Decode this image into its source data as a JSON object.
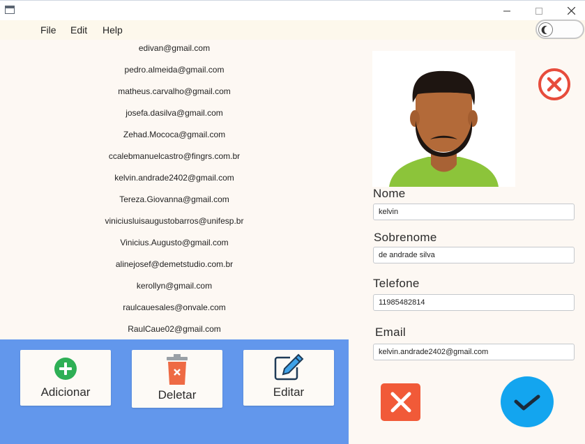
{
  "menu": {
    "items": [
      "File",
      "Edit",
      "Help"
    ]
  },
  "emails": [
    "edivan@gmail.com",
    "pedro.almeida@gmail.com",
    "matheus.carvalho@gmail.com",
    "josefa.dasilva@gmail.com",
    "Zehad.Mococa@gmail.com",
    "ccalebmanuelcastro@fingrs.com.br",
    "kelvin.andrade2402@gmail.com",
    "Tereza.Giovanna@gmail.com",
    "viniciusluisaugustobarros@unifesp.br",
    "Vinicius.Augusto@gmail.com",
    "alinejosef@demetstudio.com.br",
    "kerollyn@gmail.com",
    "raulcauesales@onvale.com",
    "RaulCaue02@gmail.com"
  ],
  "actions": {
    "add_label": "Adicionar",
    "delete_label": "Deletar",
    "edit_label": "Editar"
  },
  "form": {
    "nome_label": "Nome",
    "nome_value": "kelvin",
    "sobrenome_label": "Sobrenome",
    "sobrenome_value": "de andrade silva",
    "telefone_label": "Telefone",
    "telefone_value": "11985482814",
    "email_label": "Email",
    "email_value": "kelvin.andrade2402@gmail.com"
  },
  "icons": {
    "add": "plus-circle-icon",
    "delete": "trash-icon",
    "edit": "edit-pencil-icon",
    "remove_photo": "close-circle-icon",
    "cancel": "close-icon",
    "confirm": "check-icon",
    "theme_toggle": "moon-icon"
  },
  "colors": {
    "action_panel": "#6297ec",
    "cancel": "#f15a38",
    "confirm": "#13a5ef",
    "add_icon": "#2eaf55",
    "delete_icon": "#ee6a44",
    "remove_photo": "#e74c3c"
  }
}
